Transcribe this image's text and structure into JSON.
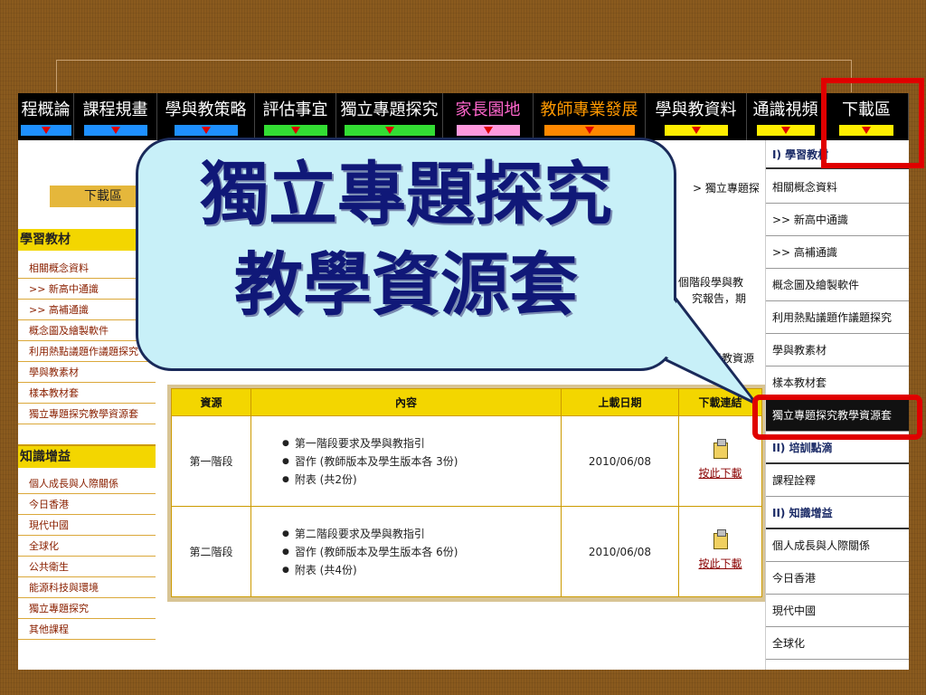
{
  "nav": {
    "items": [
      {
        "label": "程概論",
        "color": "#1e90ff"
      },
      {
        "label": "課程規畫",
        "color": "#1e90ff"
      },
      {
        "label": "學與教策略",
        "color": "#1e90ff"
      },
      {
        "label": "評估事宜",
        "color": "#33dd33"
      },
      {
        "label": "獨立專題探究",
        "color": "#33dd33"
      },
      {
        "label": "家長園地",
        "color": "#ff99dd"
      },
      {
        "label": "教師專業發展",
        "color": "#ff8800"
      },
      {
        "label": "學與教資料",
        "color": "#ffee00"
      },
      {
        "label": "通識視頻",
        "color": "#ffee00"
      },
      {
        "label": "下載區",
        "color": "#ffee00"
      }
    ]
  },
  "left": {
    "title": "下載區",
    "sec1": "學習教材",
    "items1": [
      "相關概念資料",
      ">> 新高中通識",
      ">> 高補通識",
      "概念圖及繪製軟件",
      "利用熱點議題作議題探究",
      "學與教素材",
      "樣本教材套",
      "獨立專題探究教學資源套"
    ],
    "sec2": "知識增益",
    "items2": [
      "個人成長與人際關係",
      "今日香港",
      "現代中國",
      "全球化",
      "公共衛生",
      "能源科技與環境",
      "獨立專題探究",
      "其他課程"
    ]
  },
  "right": {
    "items": [
      "I) 學習教材",
      "相關概念資料",
      ">> 新高中通識",
      ">> 高補通識",
      "概念圖及繪製軟件",
      "利用熱點議題作議題探究",
      "學與教素材",
      "樣本教材套",
      "獨立專題探究教學資源套",
      "II) 培訓點滴",
      "課程詮釋",
      "II) 知識增益",
      "個人成長與人際關係",
      "今日香港",
      "現代中國",
      "全球化"
    ]
  },
  "main": {
    "breadcrumb": "> 獨立專題探",
    "bg_line1": "個階段學與教",
    "bg_line2": "究報告，期",
    "bg_line3": "段的學與教資源"
  },
  "table": {
    "headers": [
      "資源",
      "內容",
      "上載日期",
      "下載連結"
    ],
    "rows": [
      {
        "stage": "第一階段",
        "content": [
          "第一階段要求及學與教指引",
          "習作 (教師版本及學生版本各 3份)",
          "附表 (共2份)"
        ],
        "date": "2010/06/08",
        "link": "按此下載"
      },
      {
        "stage": "第二階段",
        "content": [
          "第二階段要求及學與教指引",
          "習作 (教師版本及學生版本各 6份)",
          "附表 (共4份)"
        ],
        "date": "2010/06/08",
        "link": "按此下載"
      }
    ]
  },
  "callout": {
    "line1": "獨立專題探究",
    "line2": "教學資源套"
  },
  "colors": {
    "highlight": "#e00000",
    "gold": "#f3d600"
  }
}
